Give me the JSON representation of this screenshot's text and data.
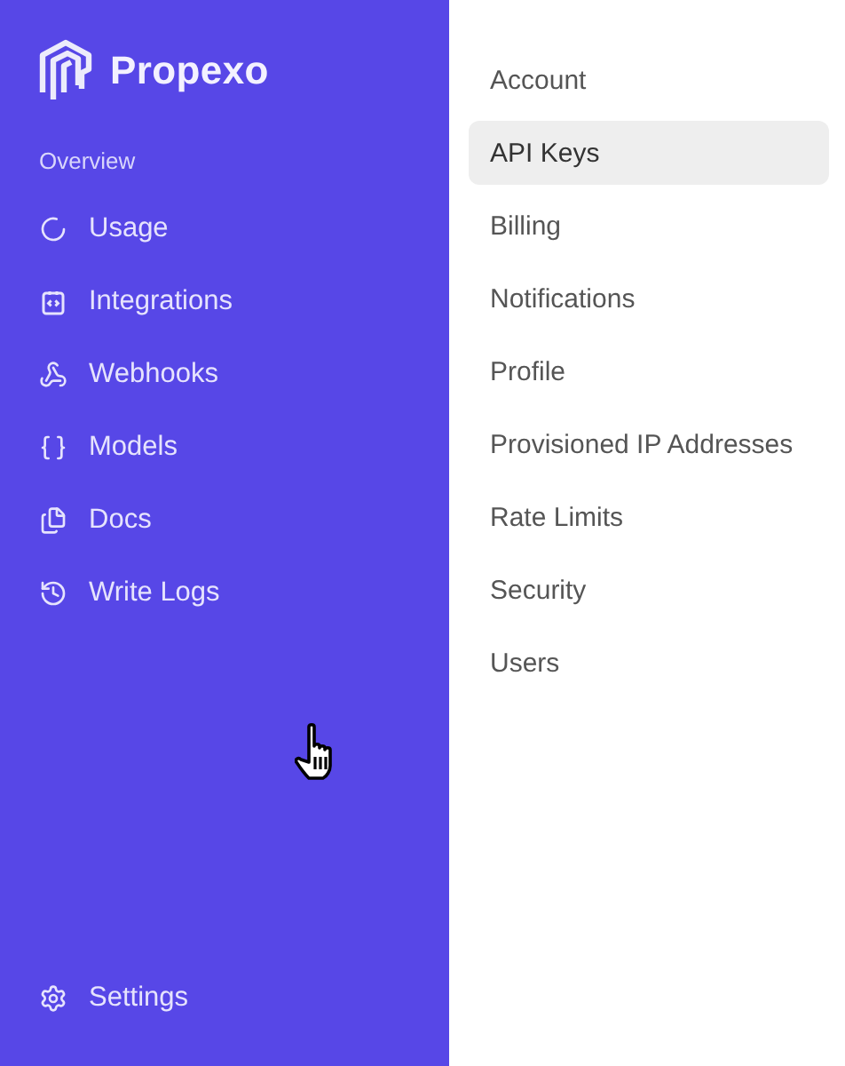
{
  "sidebar": {
    "brand": "Propexo",
    "section_label": "Overview",
    "items": [
      {
        "label": "Usage"
      },
      {
        "label": "Integrations"
      },
      {
        "label": "Webhooks"
      },
      {
        "label": "Models"
      },
      {
        "label": "Docs"
      },
      {
        "label": "Write Logs"
      }
    ],
    "footer_item": {
      "label": "Settings"
    }
  },
  "settings_menu": [
    {
      "label": "Account",
      "selected": false
    },
    {
      "label": "API Keys",
      "selected": true
    },
    {
      "label": "Billing",
      "selected": false
    },
    {
      "label": "Notifications",
      "selected": false
    },
    {
      "label": "Profile",
      "selected": false
    },
    {
      "label": "Provisioned IP Addresses",
      "selected": false
    },
    {
      "label": "Rate Limits",
      "selected": false
    },
    {
      "label": "Security",
      "selected": false
    },
    {
      "label": "Users",
      "selected": false
    }
  ]
}
